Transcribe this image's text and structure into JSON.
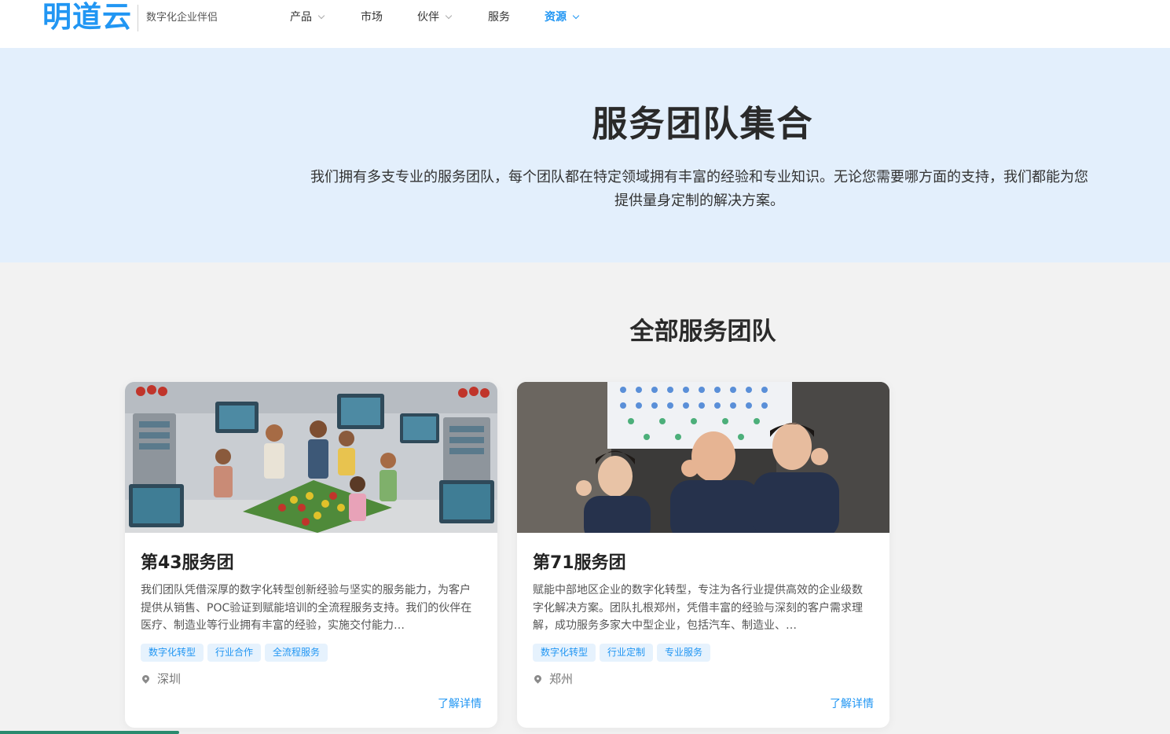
{
  "header": {
    "logo": "明道云",
    "tagline": "数字化企业伴侣",
    "nav": [
      {
        "label": "产品",
        "dropdown": true,
        "active": false
      },
      {
        "label": "市场",
        "dropdown": false,
        "active": false
      },
      {
        "label": "伙伴",
        "dropdown": true,
        "active": false
      },
      {
        "label": "服务",
        "dropdown": false,
        "active": false
      },
      {
        "label": "资源",
        "dropdown": true,
        "active": true
      }
    ]
  },
  "hero": {
    "title": "服务团队集合",
    "description": "我们拥有多支专业的服务团队，每个团队都在特定领域拥有丰富的经验和专业知识。无论您需要哪方面的支持，我们都能为您提供量身定制的解决方案。"
  },
  "section": {
    "title": "全部服务团队"
  },
  "cards": [
    {
      "title": "第43服务团",
      "description": "我们团队凭借深厚的数字化转型创新经验与坚实的服务能力，为客户提供从销售、POC验证到赋能培训的全流程服务支持。我们的伙伴在医疗、制造业等行业拥有丰富的经验，实施交付能力…",
      "tags": [
        "数字化转型",
        "行业合作",
        "全流程服务"
      ],
      "location": "深圳",
      "more_label": "了解详情"
    },
    {
      "title": "第71服务团",
      "description": "赋能中部地区企业的数字化转型，专注为各行业提供高效的企业级数字化解决方案。团队扎根郑州，凭借丰富的经验与深刻的客户需求理解，成功服务多家大中型企业，包括汽车、制造业、…",
      "tags": [
        "数字化转型",
        "行业定制",
        "专业服务"
      ],
      "location": "郑州",
      "more_label": "了解详情"
    }
  ],
  "colors": {
    "accent": "#2196f3",
    "hero_bg": "#e3effc",
    "page_bg": "#f2f2f2",
    "tag_bg": "#e6f2fd"
  }
}
